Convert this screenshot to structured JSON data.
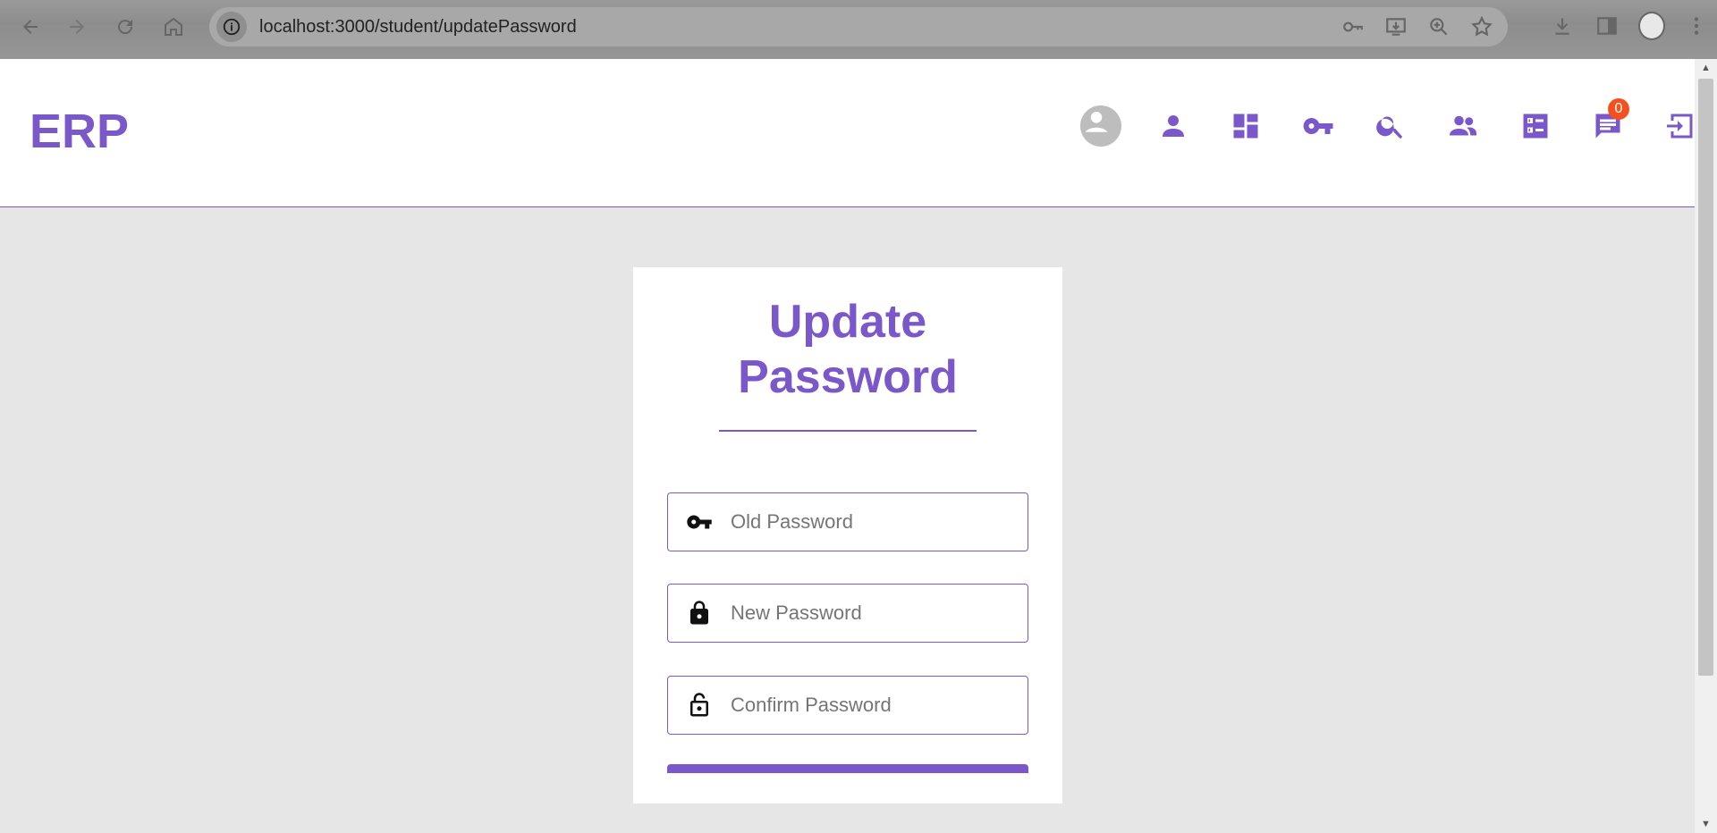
{
  "browser": {
    "url": "localhost:3000/student/updatePassword"
  },
  "header": {
    "logo": "ERP",
    "notification_count": "0",
    "icons": [
      "avatar",
      "person-icon",
      "dashboard-icon",
      "key-icon",
      "search-icon",
      "group-icon",
      "list-icon",
      "chat-icon",
      "logout-icon"
    ]
  },
  "form": {
    "title_line1": "Update",
    "title_line2": "Password",
    "fields": [
      {
        "placeholder": "Old Password",
        "icon": "key-icon"
      },
      {
        "placeholder": "New Password",
        "icon": "lock-icon"
      },
      {
        "placeholder": "Confirm Password",
        "icon": "lock-open-icon"
      }
    ]
  },
  "colors": {
    "accent": "#7b58c9",
    "badge": "#f4511e",
    "background": "#e6e6e6"
  }
}
